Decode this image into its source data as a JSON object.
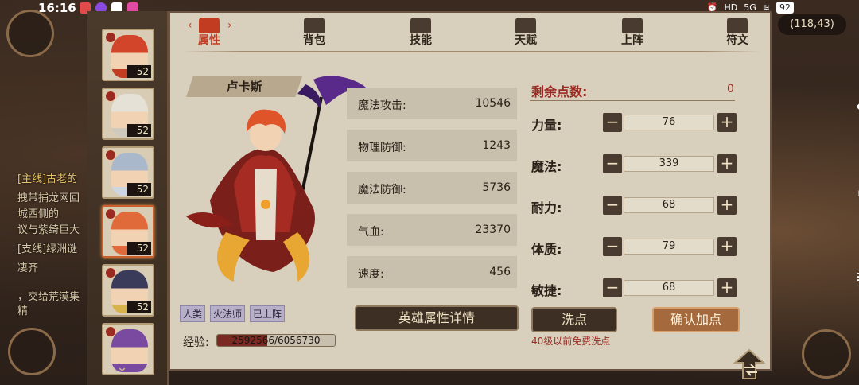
{
  "status_bar": {
    "time": "16:16",
    "icons": [
      "notification-icon",
      "alarm-icon",
      "hd-icon",
      "5g-icon",
      "wifi-icon"
    ],
    "hd": "HD",
    "network": "5G",
    "battery": "92"
  },
  "map": {
    "coords": "(118,43)"
  },
  "chat_snippets": [
    {
      "text": "[主线]古老的",
      "color": "gold"
    },
    {
      "text": "拽带捕龙网回",
      "color": "normal"
    },
    {
      "text": "城西侧的",
      "color": "normal"
    },
    {
      "text": "议与紫绮巨大",
      "color": "normal"
    },
    {
      "text": "[支线]绿洲谜",
      "color": "normal"
    },
    {
      "text": "凄齐",
      "color": "normal"
    },
    {
      "text": "，交给荒漠集",
      "color": "normal"
    },
    {
      "text": "精",
      "color": "normal"
    }
  ],
  "roster": {
    "heroes": [
      {
        "level": "52",
        "color": "#c23c22",
        "hair": "#d2452a"
      },
      {
        "level": "52",
        "color": "#cfcac0",
        "hair": "#e6e1d6"
      },
      {
        "level": "52",
        "color": "#cdd6e2",
        "hair": "#aab8cc"
      },
      {
        "level": "52",
        "color": "#e06a3a",
        "hair": "#e06a3a"
      },
      {
        "level": "52",
        "color": "#d8b24a",
        "hair": "#3a3a5a"
      },
      {
        "level": "",
        "color": "#7a4aa0",
        "hair": "#7a4aa0"
      }
    ],
    "active_index": 3
  },
  "tabs": [
    {
      "label": "属性",
      "icon": "flame-icon",
      "active": true
    },
    {
      "label": "背包",
      "icon": "bag-icon",
      "active": false
    },
    {
      "label": "技能",
      "icon": "book-icon",
      "active": false
    },
    {
      "label": "天赋",
      "icon": "eye-icon",
      "active": false
    },
    {
      "label": "上阵",
      "icon": "swords-icon",
      "active": false
    },
    {
      "label": "符文",
      "icon": "rune-icon",
      "active": false
    }
  ],
  "hero": {
    "name": "卢卡斯",
    "tags": [
      "人类",
      "火法师",
      "已上阵"
    ],
    "exp_label": "经验:",
    "exp_text": "2592566/6056730",
    "exp_fraction": 0.428
  },
  "stats": [
    {
      "key": "魔法攻击:",
      "value": "10546"
    },
    {
      "key": "物理防御:",
      "value": "1243"
    },
    {
      "key": "魔法防御:",
      "value": "5736"
    },
    {
      "key": "气血:",
      "value": "23370"
    },
    {
      "key": "速度:",
      "value": "456"
    }
  ],
  "detail_button": "英雄属性详情",
  "allocation": {
    "remaining_label": "剩余点数:",
    "remaining_value": "0",
    "rows": [
      {
        "key": "力量:",
        "value": "76"
      },
      {
        "key": "魔法:",
        "value": "339"
      },
      {
        "key": "耐力:",
        "value": "68"
      },
      {
        "key": "体质:",
        "value": "79"
      },
      {
        "key": "敏捷:",
        "value": "68"
      }
    ],
    "minus": "−",
    "plus": "+"
  },
  "reset_button": "洗点",
  "reset_note": "40级以前免费洗点",
  "confirm_button": "确认加点"
}
